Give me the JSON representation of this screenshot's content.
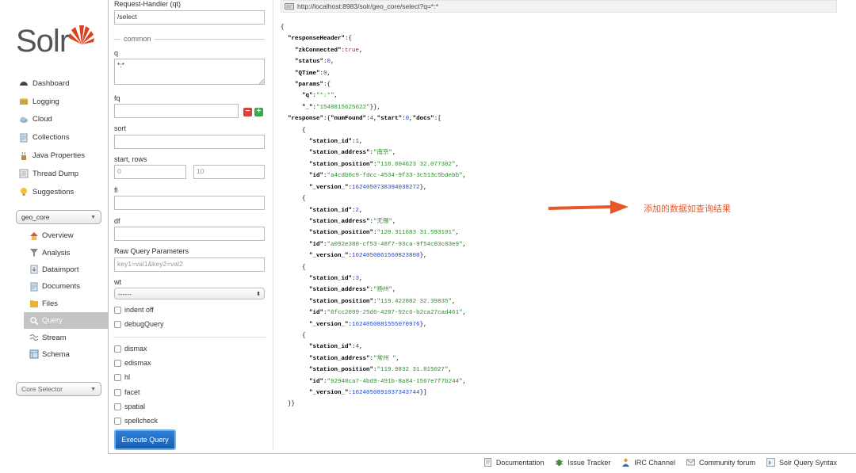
{
  "brand": {
    "logo_text": "Solr",
    "accent": "#d9411e"
  },
  "nav": {
    "items": [
      {
        "label": "Dashboard",
        "icon": "dashboard-icon"
      },
      {
        "label": "Logging",
        "icon": "logging-icon"
      },
      {
        "label": "Cloud",
        "icon": "cloud-icon"
      },
      {
        "label": "Collections",
        "icon": "collections-icon"
      },
      {
        "label": "Java Properties",
        "icon": "java-icon"
      },
      {
        "label": "Thread Dump",
        "icon": "thread-dump-icon"
      },
      {
        "label": "Suggestions",
        "icon": "bulb-icon"
      }
    ],
    "core_select": "geo_core",
    "core_items": [
      {
        "label": "Overview",
        "icon": "home-icon"
      },
      {
        "label": "Analysis",
        "icon": "filter-icon"
      },
      {
        "label": "Dataimport",
        "icon": "dataimport-icon"
      },
      {
        "label": "Documents",
        "icon": "documents-icon"
      },
      {
        "label": "Files",
        "icon": "folder-icon"
      },
      {
        "label": "Query",
        "icon": "query-icon",
        "active": true
      },
      {
        "label": "Stream",
        "icon": "stream-icon"
      },
      {
        "label": "Schema",
        "icon": "schema-icon"
      }
    ],
    "core_selector": "Core Selector"
  },
  "form": {
    "request_handler_label": "Request-Handler (qt)",
    "request_handler_value": "/select",
    "common_label": "common",
    "q_label": "q",
    "q_value": "*:*",
    "fq_label": "fq",
    "fq_value": "",
    "sort_label": "sort",
    "sort_value": "",
    "start_rows_label": "start, rows",
    "start_value": "0",
    "rows_value": "10",
    "fl_label": "fl",
    "fl_value": "",
    "df_label": "df",
    "df_value": "",
    "raw_label": "Raw Query Parameters",
    "raw_placeholder": "key1=val1&key2=val2",
    "wt_label": "wt",
    "wt_value": "------",
    "indent_label": "indent off",
    "debug_label": "debugQuery",
    "dismax_label": "dismax",
    "edismax_label": "edismax",
    "hl_label": "hl",
    "facet_label": "facet",
    "spatial_label": "spatial",
    "spellcheck_label": "spellcheck",
    "execute_label": "Execute Query"
  },
  "url": "http://localhost:8983/solr/geo_core/select?q=*:*",
  "response": {
    "zkConnected": "true",
    "status": "0",
    "QTime": "0",
    "q": "\"*:*\"",
    "underscore": "\"1548815625622\"",
    "numFound": "4",
    "start": "0",
    "docs": [
      {
        "station_id": "1",
        "station_address": "\"南京\"",
        "station_position": "\"118.804623 32.077302\"",
        "id": "\"a4cdb0c9-fdcc-4534-9f33-3c513c5bdebb\"",
        "version": "1624050738394038272"
      },
      {
        "station_id": "2",
        "station_address": "\"无锡\"",
        "station_position": "\"120.311683 31.593101\"",
        "id": "\"a092e380-cf53-48f7-93ca-9f54c03c03e9\"",
        "version": "1624050861560823808"
      },
      {
        "station_id": "3",
        "station_address": "\"扬州\"",
        "station_position": "\"119.422082 32.39835\"",
        "id": "\"8fcc2099-25d6-4287-92c6-b2ca27cad461\"",
        "version": "1624050881555070976"
      },
      {
        "station_id": "4",
        "station_address": "\"常州 \"",
        "station_position": "\"119.9832 31.815027\"",
        "id": "\"92948ca7-4bd9-491b-8a84-1567e7f7b244\"",
        "version": "1624050891037343744"
      }
    ]
  },
  "annotation": "添加的数据如查询结果",
  "footer": [
    {
      "label": "Documentation",
      "icon": "documentation-icon"
    },
    {
      "label": "Issue Tracker",
      "icon": "bug-icon"
    },
    {
      "label": "IRC Channel",
      "icon": "irc-icon"
    },
    {
      "label": "Community forum",
      "icon": "mail-icon"
    },
    {
      "label": "Solr Query Syntax",
      "icon": "syntax-icon"
    }
  ]
}
